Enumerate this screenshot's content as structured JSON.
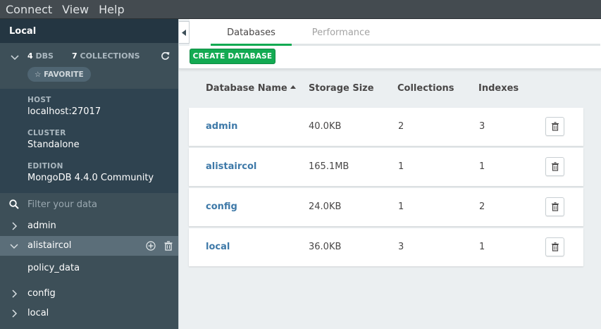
{
  "menubar": {
    "items": [
      "Connect",
      "View",
      "Help"
    ]
  },
  "sidebar": {
    "title": "Local",
    "stats": {
      "db_count": "4",
      "db_label": "DBS",
      "coll_count": "7",
      "coll_label": "COLLECTIONS"
    },
    "favorite_label": "☆ FAVORITE",
    "info": {
      "host_label": "HOST",
      "host_value": "localhost:27017",
      "cluster_label": "CLUSTER",
      "cluster_value": "Standalone",
      "edition_label": "EDITION",
      "edition_value": "MongoDB 4.4.0 Community"
    },
    "search_placeholder": "Filter your data",
    "databases": [
      {
        "name": "admin",
        "expanded": false
      },
      {
        "name": "alistaircol",
        "expanded": true,
        "collections": [
          "policy_data"
        ]
      },
      {
        "name": "config",
        "expanded": false
      },
      {
        "name": "local",
        "expanded": false
      }
    ]
  },
  "tabs": [
    {
      "label": "Databases",
      "active": true
    },
    {
      "label": "Performance",
      "active": false
    }
  ],
  "toolbar": {
    "create_label": "CREATE DATABASE"
  },
  "table": {
    "columns": [
      "Database Name",
      "Storage Size",
      "Collections",
      "Indexes"
    ],
    "rows": [
      {
        "name": "admin",
        "storage": "40.0KB",
        "collections": "2",
        "indexes": "3"
      },
      {
        "name": "alistaircol",
        "storage": "165.1MB",
        "collections": "1",
        "indexes": "1"
      },
      {
        "name": "config",
        "storage": "24.0KB",
        "collections": "1",
        "indexes": "2"
      },
      {
        "name": "local",
        "storage": "36.0KB",
        "collections": "3",
        "indexes": "1"
      }
    ]
  },
  "colors": {
    "accent_green": "#13aa52",
    "link_blue": "#3e79a8",
    "sidebar_bg": "#3d4f58",
    "sidebar_dark": "#243642"
  }
}
